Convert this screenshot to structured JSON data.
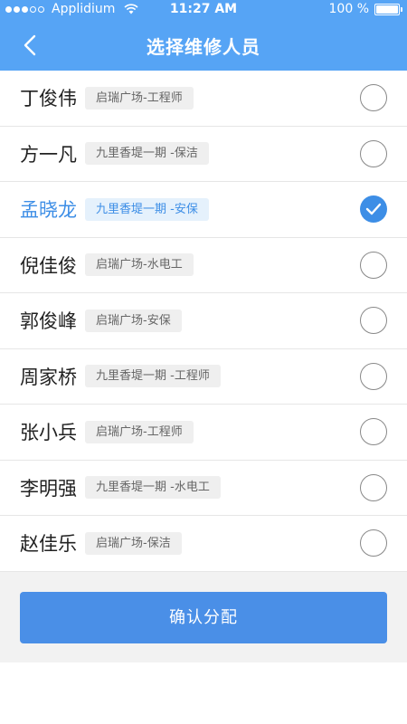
{
  "status_bar": {
    "carrier": "Applidium",
    "time": "11:27 AM",
    "battery": "100 %",
    "signal_dots": 5,
    "signal_filled": 3,
    "battery_level": 1.0,
    "icons": [
      "signal-dots-icon",
      "wifi-icon",
      "battery-icon"
    ]
  },
  "nav": {
    "title": "选择维修人员",
    "back_icon": "chevron-left-icon"
  },
  "staff": [
    {
      "name": "丁俊伟",
      "tag": "启瑞广场-工程师",
      "selected": false
    },
    {
      "name": "方一凡",
      "tag": "九里香堤一期 -保洁",
      "selected": false
    },
    {
      "name": "孟晓龙",
      "tag": "九里香堤一期 -安保",
      "selected": true
    },
    {
      "name": "倪佳俊",
      "tag": "启瑞广场-水电工",
      "selected": false
    },
    {
      "name": "郭俊峰",
      "tag": "启瑞广场-安保",
      "selected": false
    },
    {
      "name": "周家桥",
      "tag": "九里香堤一期 -工程师",
      "selected": false
    },
    {
      "name": "张小兵",
      "tag": "启瑞广场-工程师",
      "selected": false
    },
    {
      "name": "李明强",
      "tag": "九里香堤一期 -水电工",
      "selected": false
    },
    {
      "name": "赵佳乐",
      "tag": "启瑞广场-保洁",
      "selected": false
    }
  ],
  "confirm_button": "确认分配",
  "colors": {
    "header": "#56a4f5",
    "accent": "#3d8ee6",
    "button": "#4a8fe7",
    "tag_bg": "#efefef",
    "tag_selected_bg": "#e5f1fc"
  }
}
